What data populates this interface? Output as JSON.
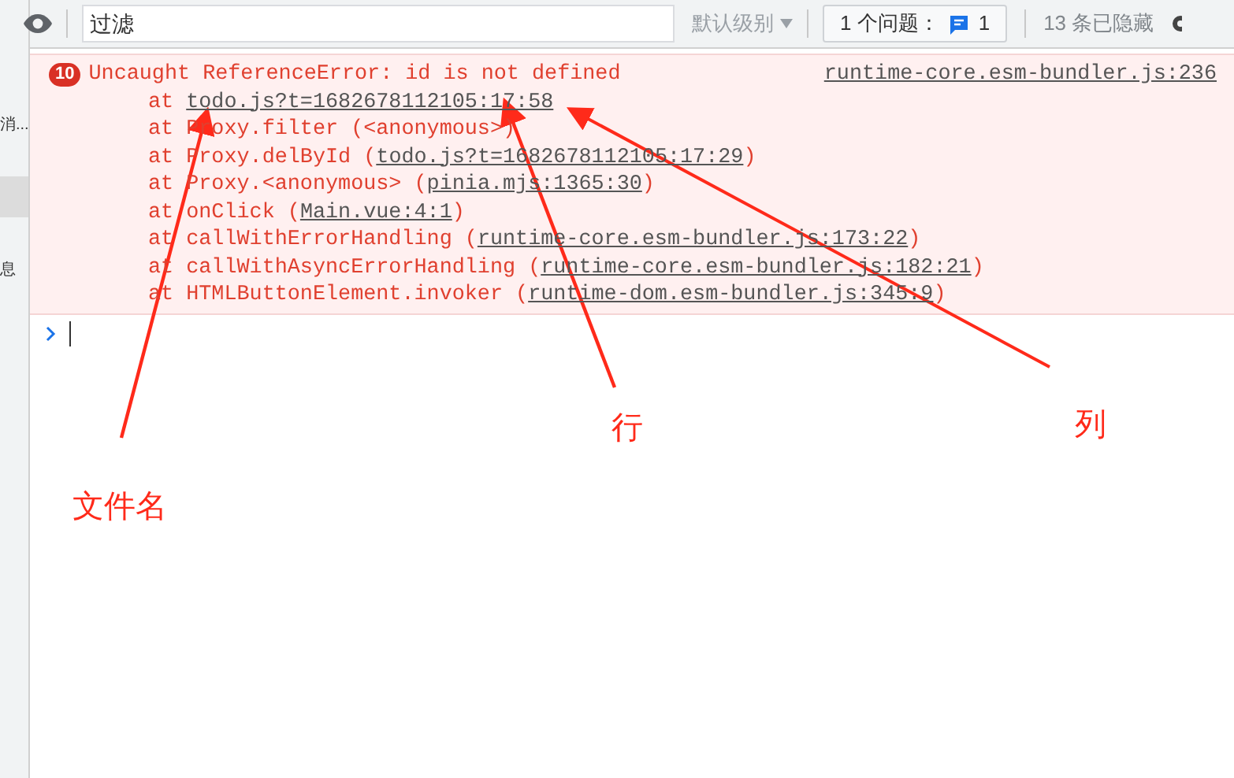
{
  "sidebar": {
    "items": [
      {
        "label": "消...",
        "selected": false
      },
      {
        "selected": true
      },
      {
        "label": "息",
        "selected": false
      }
    ]
  },
  "toolbar": {
    "filter": {
      "placeholder": "过滤"
    },
    "level_menu": "默认级别",
    "issues": {
      "label": "1 个问题：",
      "count": "1"
    },
    "hidden": "13 条已隐藏"
  },
  "error": {
    "count": "10",
    "message": "Uncaught ReferenceError: id is not defined",
    "source": "runtime-core.esm-bundler.js:236",
    "frames": [
      {
        "kind": "link",
        "prefix": "at",
        "location": "todo.js?t=1682678112105:17:58"
      },
      {
        "kind": "call",
        "prefix": "at",
        "func": "Proxy.filter",
        "open": "(",
        "location": "<anonymous>",
        "close": ")",
        "linked": false
      },
      {
        "kind": "call",
        "prefix": "at",
        "func": "Proxy.delById",
        "open": "(",
        "close": ")",
        "location": "todo.js?t=1682678112105:17:29",
        "linked": true
      },
      {
        "kind": "call",
        "prefix": "at",
        "func": "Proxy.<anonymous>",
        "open": "(",
        "close": ")",
        "location": "pinia.mjs:1365:30",
        "linked": true
      },
      {
        "kind": "call",
        "prefix": "at",
        "func": "onClick",
        "open": "(",
        "close": ")",
        "location": "Main.vue:4:1",
        "linked": true
      },
      {
        "kind": "call",
        "prefix": "at",
        "func": "callWithErrorHandling",
        "open": "(",
        "close": ")",
        "location": "runtime-core.esm-bundler.js:173:22",
        "linked": true
      },
      {
        "kind": "call",
        "prefix": "at",
        "func": "callWithAsyncErrorHandling",
        "open": "(",
        "close": ")",
        "location": "runtime-core.esm-bundler.js:182:21",
        "linked": true
      },
      {
        "kind": "call",
        "prefix": "at",
        "func": "HTMLButtonElement.invoker",
        "open": "(",
        "close": ")",
        "location": "runtime-dom.esm-bundler.js:345:9",
        "linked": true
      }
    ]
  },
  "annotations": [
    {
      "label": "文件名"
    },
    {
      "label": "行"
    },
    {
      "label": "列"
    }
  ]
}
